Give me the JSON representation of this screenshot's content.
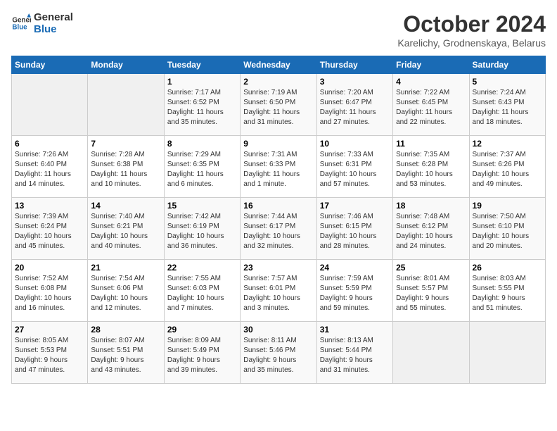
{
  "logo": {
    "line1": "General",
    "line2": "Blue"
  },
  "title": "October 2024",
  "subtitle": "Karelichy, Grodnenskaya, Belarus",
  "days_of_week": [
    "Sunday",
    "Monday",
    "Tuesday",
    "Wednesday",
    "Thursday",
    "Friday",
    "Saturday"
  ],
  "weeks": [
    [
      {
        "day": "",
        "info": ""
      },
      {
        "day": "",
        "info": ""
      },
      {
        "day": "1",
        "info": "Sunrise: 7:17 AM\nSunset: 6:52 PM\nDaylight: 11 hours\nand 35 minutes."
      },
      {
        "day": "2",
        "info": "Sunrise: 7:19 AM\nSunset: 6:50 PM\nDaylight: 11 hours\nand 31 minutes."
      },
      {
        "day": "3",
        "info": "Sunrise: 7:20 AM\nSunset: 6:47 PM\nDaylight: 11 hours\nand 27 minutes."
      },
      {
        "day": "4",
        "info": "Sunrise: 7:22 AM\nSunset: 6:45 PM\nDaylight: 11 hours\nand 22 minutes."
      },
      {
        "day": "5",
        "info": "Sunrise: 7:24 AM\nSunset: 6:43 PM\nDaylight: 11 hours\nand 18 minutes."
      }
    ],
    [
      {
        "day": "6",
        "info": "Sunrise: 7:26 AM\nSunset: 6:40 PM\nDaylight: 11 hours\nand 14 minutes."
      },
      {
        "day": "7",
        "info": "Sunrise: 7:28 AM\nSunset: 6:38 PM\nDaylight: 11 hours\nand 10 minutes."
      },
      {
        "day": "8",
        "info": "Sunrise: 7:29 AM\nSunset: 6:35 PM\nDaylight: 11 hours\nand 6 minutes."
      },
      {
        "day": "9",
        "info": "Sunrise: 7:31 AM\nSunset: 6:33 PM\nDaylight: 11 hours\nand 1 minute."
      },
      {
        "day": "10",
        "info": "Sunrise: 7:33 AM\nSunset: 6:31 PM\nDaylight: 10 hours\nand 57 minutes."
      },
      {
        "day": "11",
        "info": "Sunrise: 7:35 AM\nSunset: 6:28 PM\nDaylight: 10 hours\nand 53 minutes."
      },
      {
        "day": "12",
        "info": "Sunrise: 7:37 AM\nSunset: 6:26 PM\nDaylight: 10 hours\nand 49 minutes."
      }
    ],
    [
      {
        "day": "13",
        "info": "Sunrise: 7:39 AM\nSunset: 6:24 PM\nDaylight: 10 hours\nand 45 minutes."
      },
      {
        "day": "14",
        "info": "Sunrise: 7:40 AM\nSunset: 6:21 PM\nDaylight: 10 hours\nand 40 minutes."
      },
      {
        "day": "15",
        "info": "Sunrise: 7:42 AM\nSunset: 6:19 PM\nDaylight: 10 hours\nand 36 minutes."
      },
      {
        "day": "16",
        "info": "Sunrise: 7:44 AM\nSunset: 6:17 PM\nDaylight: 10 hours\nand 32 minutes."
      },
      {
        "day": "17",
        "info": "Sunrise: 7:46 AM\nSunset: 6:15 PM\nDaylight: 10 hours\nand 28 minutes."
      },
      {
        "day": "18",
        "info": "Sunrise: 7:48 AM\nSunset: 6:12 PM\nDaylight: 10 hours\nand 24 minutes."
      },
      {
        "day": "19",
        "info": "Sunrise: 7:50 AM\nSunset: 6:10 PM\nDaylight: 10 hours\nand 20 minutes."
      }
    ],
    [
      {
        "day": "20",
        "info": "Sunrise: 7:52 AM\nSunset: 6:08 PM\nDaylight: 10 hours\nand 16 minutes."
      },
      {
        "day": "21",
        "info": "Sunrise: 7:54 AM\nSunset: 6:06 PM\nDaylight: 10 hours\nand 12 minutes."
      },
      {
        "day": "22",
        "info": "Sunrise: 7:55 AM\nSunset: 6:03 PM\nDaylight: 10 hours\nand 7 minutes."
      },
      {
        "day": "23",
        "info": "Sunrise: 7:57 AM\nSunset: 6:01 PM\nDaylight: 10 hours\nand 3 minutes."
      },
      {
        "day": "24",
        "info": "Sunrise: 7:59 AM\nSunset: 5:59 PM\nDaylight: 9 hours\nand 59 minutes."
      },
      {
        "day": "25",
        "info": "Sunrise: 8:01 AM\nSunset: 5:57 PM\nDaylight: 9 hours\nand 55 minutes."
      },
      {
        "day": "26",
        "info": "Sunrise: 8:03 AM\nSunset: 5:55 PM\nDaylight: 9 hours\nand 51 minutes."
      }
    ],
    [
      {
        "day": "27",
        "info": "Sunrise: 8:05 AM\nSunset: 5:53 PM\nDaylight: 9 hours\nand 47 minutes."
      },
      {
        "day": "28",
        "info": "Sunrise: 8:07 AM\nSunset: 5:51 PM\nDaylight: 9 hours\nand 43 minutes."
      },
      {
        "day": "29",
        "info": "Sunrise: 8:09 AM\nSunset: 5:49 PM\nDaylight: 9 hours\nand 39 minutes."
      },
      {
        "day": "30",
        "info": "Sunrise: 8:11 AM\nSunset: 5:46 PM\nDaylight: 9 hours\nand 35 minutes."
      },
      {
        "day": "31",
        "info": "Sunrise: 8:13 AM\nSunset: 5:44 PM\nDaylight: 9 hours\nand 31 minutes."
      },
      {
        "day": "",
        "info": ""
      },
      {
        "day": "",
        "info": ""
      }
    ]
  ]
}
